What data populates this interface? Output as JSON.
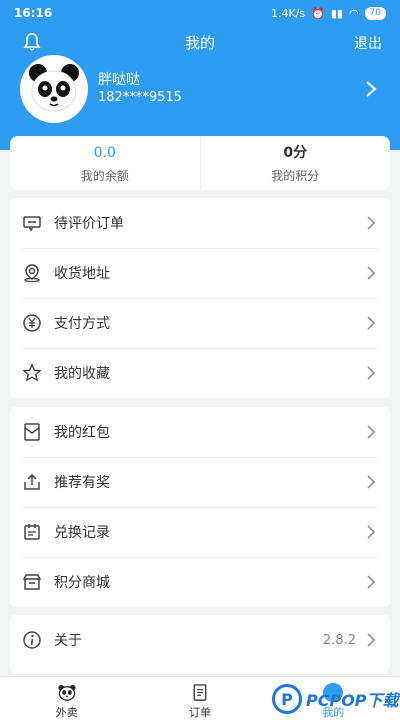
{
  "status_bar": {
    "time": "16:16",
    "network_speed": "1.4K/s",
    "battery": "70"
  },
  "header": {
    "title": "我的",
    "logout": "退出"
  },
  "profile": {
    "name": "胖哒哒",
    "phone": "182****9515"
  },
  "stats": {
    "balance": {
      "value": "0.0",
      "label": "我的余额"
    },
    "points": {
      "value": "0分",
      "label": "我的积分"
    }
  },
  "menu_group1": [
    {
      "label": "待评价订单",
      "icon": "comment-icon"
    },
    {
      "label": "收货地址",
      "icon": "location-icon"
    },
    {
      "label": "支付方式",
      "icon": "yen-icon"
    },
    {
      "label": "我的收藏",
      "icon": "star-icon"
    }
  ],
  "menu_group2": [
    {
      "label": "我的红包",
      "icon": "red-packet-icon"
    },
    {
      "label": "推荐有奖",
      "icon": "share-icon"
    },
    {
      "label": "兑换记录",
      "icon": "calendar-icon"
    },
    {
      "label": "积分商城",
      "icon": "shop-icon"
    }
  ],
  "menu_group3": [
    {
      "label": "关于",
      "value": "2.8.2",
      "icon": "info-icon"
    }
  ],
  "tabbar": [
    {
      "label": "外卖",
      "icon": "panda-icon"
    },
    {
      "label": "订单",
      "icon": "order-icon"
    },
    {
      "label": "我的",
      "icon": "profile-icon"
    }
  ],
  "watermark": {
    "text": "PCPOP下载"
  },
  "colors": {
    "primary": "#2f9cf4",
    "background": "#f2f3f5"
  }
}
